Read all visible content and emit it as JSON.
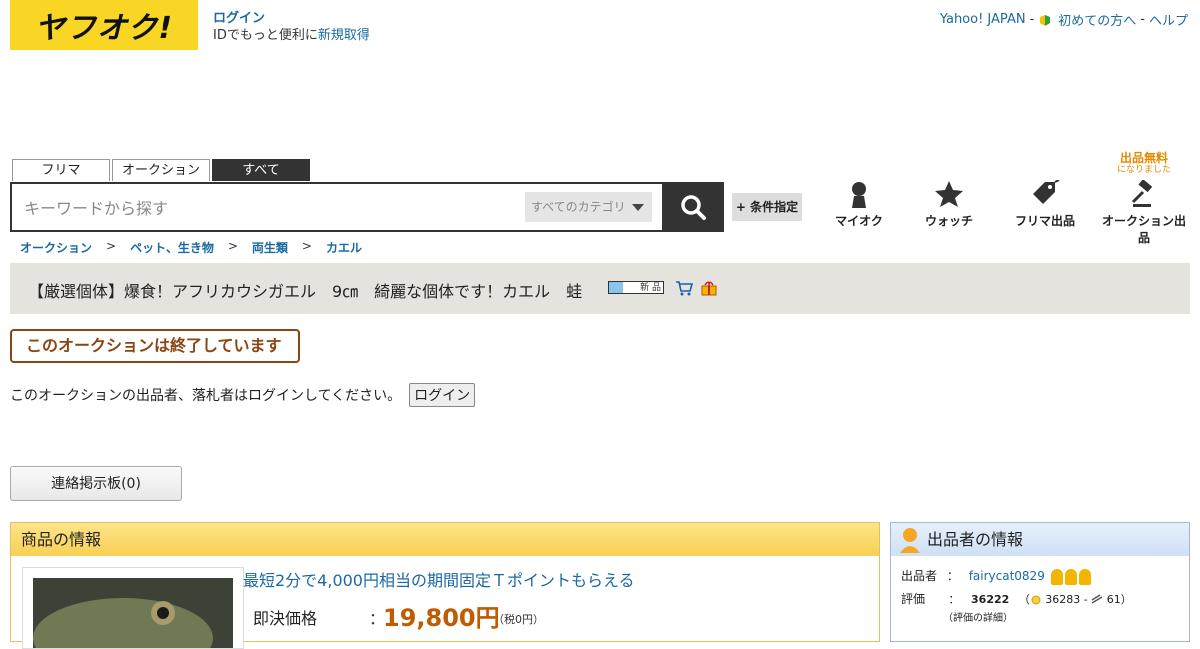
{
  "header": {
    "logo_text": "ヤフオク!",
    "login_label": "ログイン",
    "login_desc": "IDでもっと便利に",
    "register_label": "新規取得",
    "top_links": {
      "yahoo_japan": "Yahoo! JAPAN",
      "first_time": "初めての方へ",
      "help": "ヘルプ",
      "separator": "-"
    }
  },
  "search": {
    "tabs": [
      {
        "label": "フリマ",
        "active": false
      },
      {
        "label": "オークション",
        "active": false
      },
      {
        "label": "すべて",
        "active": true
      }
    ],
    "placeholder": "キーワードから探す",
    "category": "すべてのカテゴリ",
    "condition_label": "+ 条件指定"
  },
  "nav": {
    "free_badge_title": "出品無料",
    "free_badge_sub": "になりました",
    "items": [
      {
        "label": "マイオク"
      },
      {
        "label": "ウォッチ"
      },
      {
        "label": "フリマ出品"
      },
      {
        "label": "オークション出品"
      }
    ]
  },
  "breadcrumb": [
    "オークション",
    "ペット、生き物",
    "両生類",
    "カエル"
  ],
  "breadcrumb_sep": ">",
  "item": {
    "title": "【厳選個体】爆食！アフリカウシガエル　9㎝　綺麗な個体です！カエル　蛙",
    "new_badge": "新 品"
  },
  "status": {
    "ended": "このオークションは終了しています",
    "login_message": "このオークションの出品者、落札者はログインしてください。",
    "login_button": "ログイン"
  },
  "board_button": "連絡掲示板(0)",
  "product": {
    "header": "商品の情報",
    "promo": "最短2分で4,000円相当の期間固定Ｔポイントもらえる",
    "price_label": "即決価格",
    "colon": "：",
    "price": "19,800円",
    "tax": "（税0円）"
  },
  "seller": {
    "header": "出品者の情報",
    "seller_label": "出品者",
    "seller_name": "fairycat0829",
    "rating_label": "評価",
    "colon": "：",
    "rating_total": "36222",
    "rating_open": "（",
    "rating_good": "36283",
    "rating_sep": "-",
    "rating_bad": "61",
    "rating_close": "）",
    "rating_detail": "（評価の詳細）"
  },
  "colors": {
    "accent_yellow": "#f8d623",
    "link_blue": "#1a69a3",
    "price_orange": "#c25a00",
    "ended_brown": "#8b4513"
  }
}
